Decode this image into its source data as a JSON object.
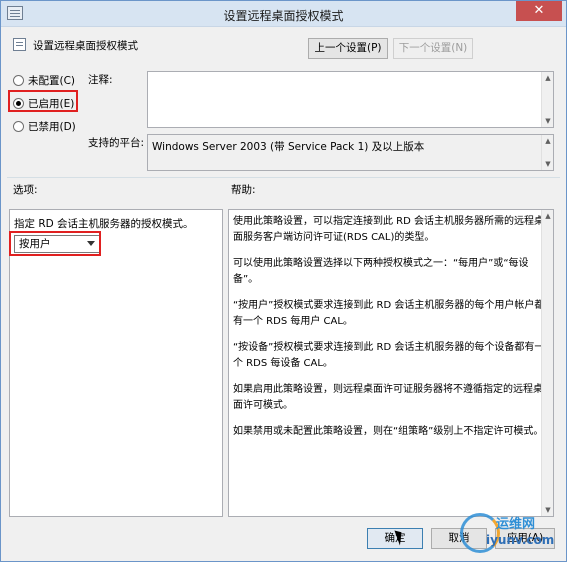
{
  "window": {
    "title": "设置远程桌面授权模式",
    "close_glyph": "✕"
  },
  "header": {
    "policy_name": "设置远程桌面授权模式",
    "prev_button": "上一个设置(P)",
    "next_button": "下一个设置(N)"
  },
  "state": {
    "options": [
      {
        "label": "未配置(C)",
        "checked": false
      },
      {
        "label": "已启用(E)",
        "checked": true
      },
      {
        "label": "已禁用(D)",
        "checked": false
      }
    ]
  },
  "comment": {
    "label": "注释:",
    "value": ""
  },
  "platform": {
    "label": "支持的平台:",
    "value": "Windows Server 2003 (带 Service Pack 1) 及以上版本"
  },
  "options_section": {
    "label": "选项:",
    "description": "指定 RD 会话主机服务器的授权模式。",
    "select_value": "按用户"
  },
  "help_section": {
    "label": "帮助:",
    "paragraphs": [
      "使用此策略设置，可以指定连接到此 RD 会话主机服务器所需的远程桌面服务客户端访问许可证(RDS CAL)的类型。",
      "可以使用此策略设置选择以下两种授权模式之一：“每用户”或“每设备”。",
      "“按用户”授权模式要求连接到此 RD 会话主机服务器的每个用户帐户都有一个 RDS 每用户 CAL。",
      "“按设备”授权模式要求连接到此 RD 会话主机服务器的每个设备都有一个 RDS 每设备 CAL。",
      "如果启用此策略设置，则远程桌面许可证服务器将不遵循指定的远程桌面许可模式。",
      "如果禁用或未配置此策略设置，则在“组策略”级别上不指定许可模式。"
    ]
  },
  "footer": {
    "ok_button": "确定",
    "cancel_button": "取消",
    "apply_button": "应用(A)"
  },
  "watermark": {
    "cn": "运维网",
    "en": "iyunv.com"
  }
}
